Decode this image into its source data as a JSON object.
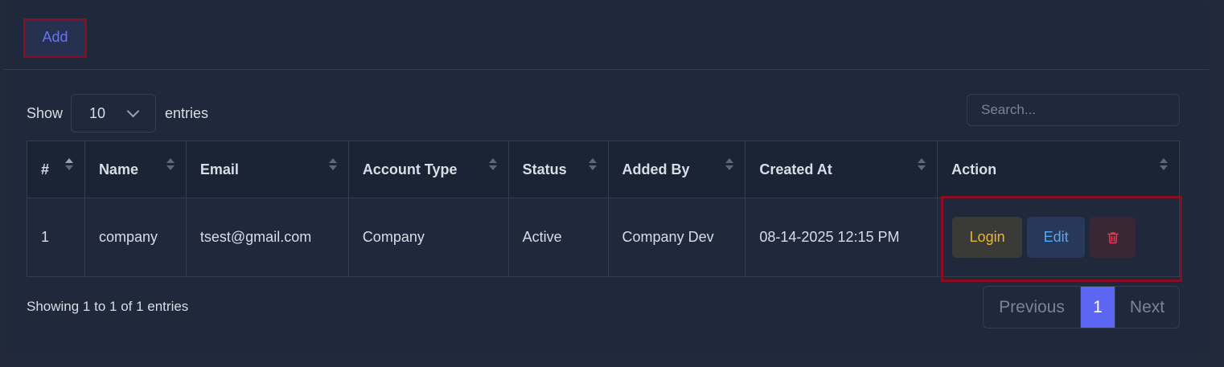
{
  "toolbar": {
    "add_label": "Add"
  },
  "length": {
    "show_label": "Show",
    "value": "10",
    "entries_label": "entries"
  },
  "search": {
    "placeholder": "Search..."
  },
  "table": {
    "headers": [
      "#",
      "Name",
      "Email",
      "Account Type",
      "Status",
      "Added By",
      "Created At",
      "Action"
    ],
    "rows": [
      {
        "num": "1",
        "name": "company",
        "email": "tsest@gmail.com",
        "account_type": "Company",
        "status": "Active",
        "added_by": "Company Dev",
        "created_at": "08-14-2025 12:15 PM"
      }
    ],
    "actions": {
      "login": "Login",
      "edit": "Edit"
    }
  },
  "footer": {
    "info": "Showing 1 to 1 of 1 entries",
    "prev": "Previous",
    "page": "1",
    "next": "Next"
  },
  "colors": {
    "primary": "#5c66f2",
    "login": "#f1b51c",
    "edit": "#58a6f5",
    "delete": "#e2394f",
    "highlight": "#8b0d21"
  }
}
